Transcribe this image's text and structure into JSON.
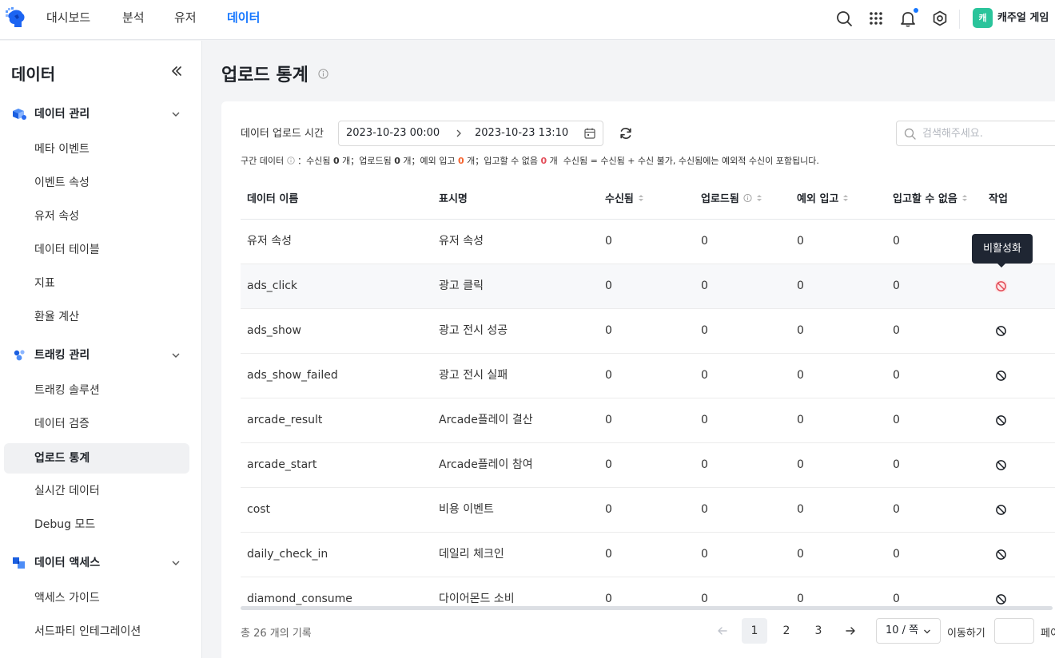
{
  "nav": {
    "tabs": [
      {
        "label": "대시보드",
        "active": false
      },
      {
        "label": "분석",
        "active": false
      },
      {
        "label": "유저",
        "active": false
      },
      {
        "label": "데이터",
        "active": true
      }
    ],
    "avatar_text": "캐",
    "game_name": "캐주얼 게임",
    "icons": [
      "search-icon",
      "apps-grid-icon",
      "bell-icon",
      "settings-icon"
    ]
  },
  "sidebar": {
    "title": "데이터",
    "groups": [
      {
        "label": "데이터 관리",
        "items": [
          "메타 이벤트",
          "이벤트 속성",
          "유저 속성",
          "데이터 테이블",
          "지표",
          "환율 계산"
        ]
      },
      {
        "label": "트래킹 관리",
        "items": [
          "트래킹 솔루션",
          "데이터 검증",
          "업로드 통계",
          "실시간 데이터",
          "Debug 모드"
        ]
      },
      {
        "label": "데이터 액세스",
        "items": [
          "액세스 가이드",
          "서드파티 인테그레이션"
        ]
      }
    ],
    "active_item": "업로드 통계"
  },
  "page": {
    "title": "업로드 통계"
  },
  "filter": {
    "label": "데이터 업로드 시간",
    "start": "2023-10-23 00:00",
    "end": "2023-10-23 13:10",
    "search_placeholder": "검색해주세요."
  },
  "summary": {
    "prefix": "구간 데이터",
    "received_label": "수신됨",
    "received": "0",
    "uploaded_label": "업로드됨",
    "uploaded": "0",
    "unexpected_label": "예외 입고",
    "unexpected": "0",
    "failed_label": "입고할 수 없음",
    "failed": "0",
    "unit": "개",
    "note": "수신됨 = 수신됨 + 수신 불가, 수신됨에는 예외적 수신이 포함됩니다."
  },
  "table": {
    "columns": [
      "데이터 이름",
      "표시명",
      "수신됨",
      "업로드됨",
      "예외 입고",
      "입고할 수 없음",
      "작업"
    ],
    "rows": [
      {
        "name": "유저 속성",
        "display": "유저 속성",
        "received": "0",
        "uploaded": "0",
        "unexpected": "0",
        "failed": "0"
      },
      {
        "name": "ads_click",
        "display": "광고 클릭",
        "received": "0",
        "uploaded": "0",
        "unexpected": "0",
        "failed": "0"
      },
      {
        "name": "ads_show",
        "display": "광고 전시 성공",
        "received": "0",
        "uploaded": "0",
        "unexpected": "0",
        "failed": "0"
      },
      {
        "name": "ads_show_failed",
        "display": "광고 전시 실패",
        "received": "0",
        "uploaded": "0",
        "unexpected": "0",
        "failed": "0"
      },
      {
        "name": "arcade_result",
        "display": "Arcade플레이 결산",
        "received": "0",
        "uploaded": "0",
        "unexpected": "0",
        "failed": "0"
      },
      {
        "name": "arcade_start",
        "display": "Arcade플레이 참여",
        "received": "0",
        "uploaded": "0",
        "unexpected": "0",
        "failed": "0"
      },
      {
        "name": "cost",
        "display": "비용 이벤트",
        "received": "0",
        "uploaded": "0",
        "unexpected": "0",
        "failed": "0"
      },
      {
        "name": "daily_check_in",
        "display": "데일리 체크인",
        "received": "0",
        "uploaded": "0",
        "unexpected": "0",
        "failed": "0"
      },
      {
        "name": "diamond_consume",
        "display": "다이어몬드 소비",
        "received": "0",
        "uploaded": "0",
        "unexpected": "0",
        "failed": "0"
      }
    ],
    "tooltip": "비활성화"
  },
  "pagination": {
    "total": "총 26 개의 기록",
    "pages": [
      "1",
      "2",
      "3"
    ],
    "current": "1",
    "page_size": "10 / 쪽",
    "jump_label": "이동하기",
    "page_label": "페이지"
  },
  "colors": {
    "accent": "#1677ff",
    "danger": "#f5632e",
    "error": "#e34d59",
    "avatar": "#2ac49b",
    "tooltip_bg": "#1f2633"
  }
}
